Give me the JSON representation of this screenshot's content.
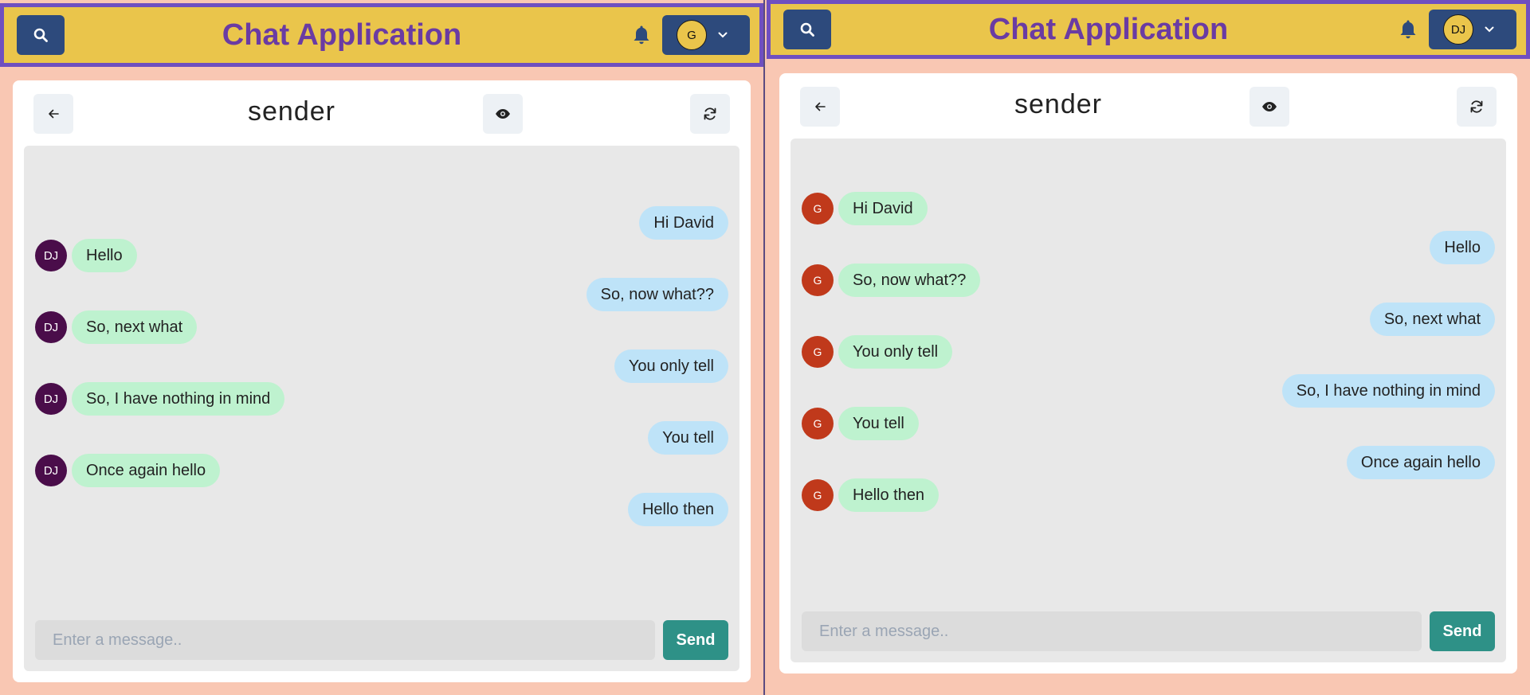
{
  "colors": {
    "header_bg": "#eac54b",
    "header_border": "#6f4fc0",
    "title": "#6a3ba3",
    "nav_button": "#2d4a7c",
    "bubble_theirs": "#bef2cf",
    "bubble_mine": "#bee3f8",
    "send_button": "#2e9187",
    "avatar_dj": "#4a0d4a",
    "avatar_g": "#c0391b"
  },
  "windows": [
    {
      "header": {
        "title": "Chat Application",
        "search_icon": "search-icon",
        "bell_icon": "bell-icon",
        "user_initials": "G"
      },
      "chat": {
        "name": "sender",
        "back_icon": "arrow-left-icon",
        "view_icon": "eye-icon",
        "refresh_icon": "refresh-icon",
        "avatar_initials": "DJ",
        "messages": [
          {
            "text": "Hi David",
            "mine": true
          },
          {
            "text": "Hello",
            "mine": false
          },
          {
            "text": "So, now what??",
            "mine": true
          },
          {
            "text": "So, next what",
            "mine": false
          },
          {
            "text": "You only tell",
            "mine": true
          },
          {
            "text": "So, I have nothing in mind",
            "mine": false
          },
          {
            "text": "You tell",
            "mine": true
          },
          {
            "text": "Once again hello",
            "mine": false
          },
          {
            "text": "Hello then",
            "mine": true
          }
        ],
        "input_placeholder": "Enter a message..",
        "send_label": "Send"
      }
    },
    {
      "header": {
        "title": "Chat Application",
        "search_icon": "search-icon",
        "bell_icon": "bell-icon",
        "user_initials": "DJ"
      },
      "chat": {
        "name": "sender",
        "back_icon": "arrow-left-icon",
        "view_icon": "eye-icon",
        "refresh_icon": "refresh-icon",
        "avatar_initials": "G",
        "messages": [
          {
            "text": "Hi David",
            "mine": false
          },
          {
            "text": "Hello",
            "mine": true
          },
          {
            "text": "So, now what??",
            "mine": false
          },
          {
            "text": "So, next what",
            "mine": true
          },
          {
            "text": "You only tell",
            "mine": false
          },
          {
            "text": "So, I have nothing in mind",
            "mine": true
          },
          {
            "text": "You tell",
            "mine": false
          },
          {
            "text": "Once again hello",
            "mine": true
          },
          {
            "text": "Hello then",
            "mine": false
          }
        ],
        "input_placeholder": "Enter a message..",
        "send_label": "Send"
      }
    }
  ]
}
